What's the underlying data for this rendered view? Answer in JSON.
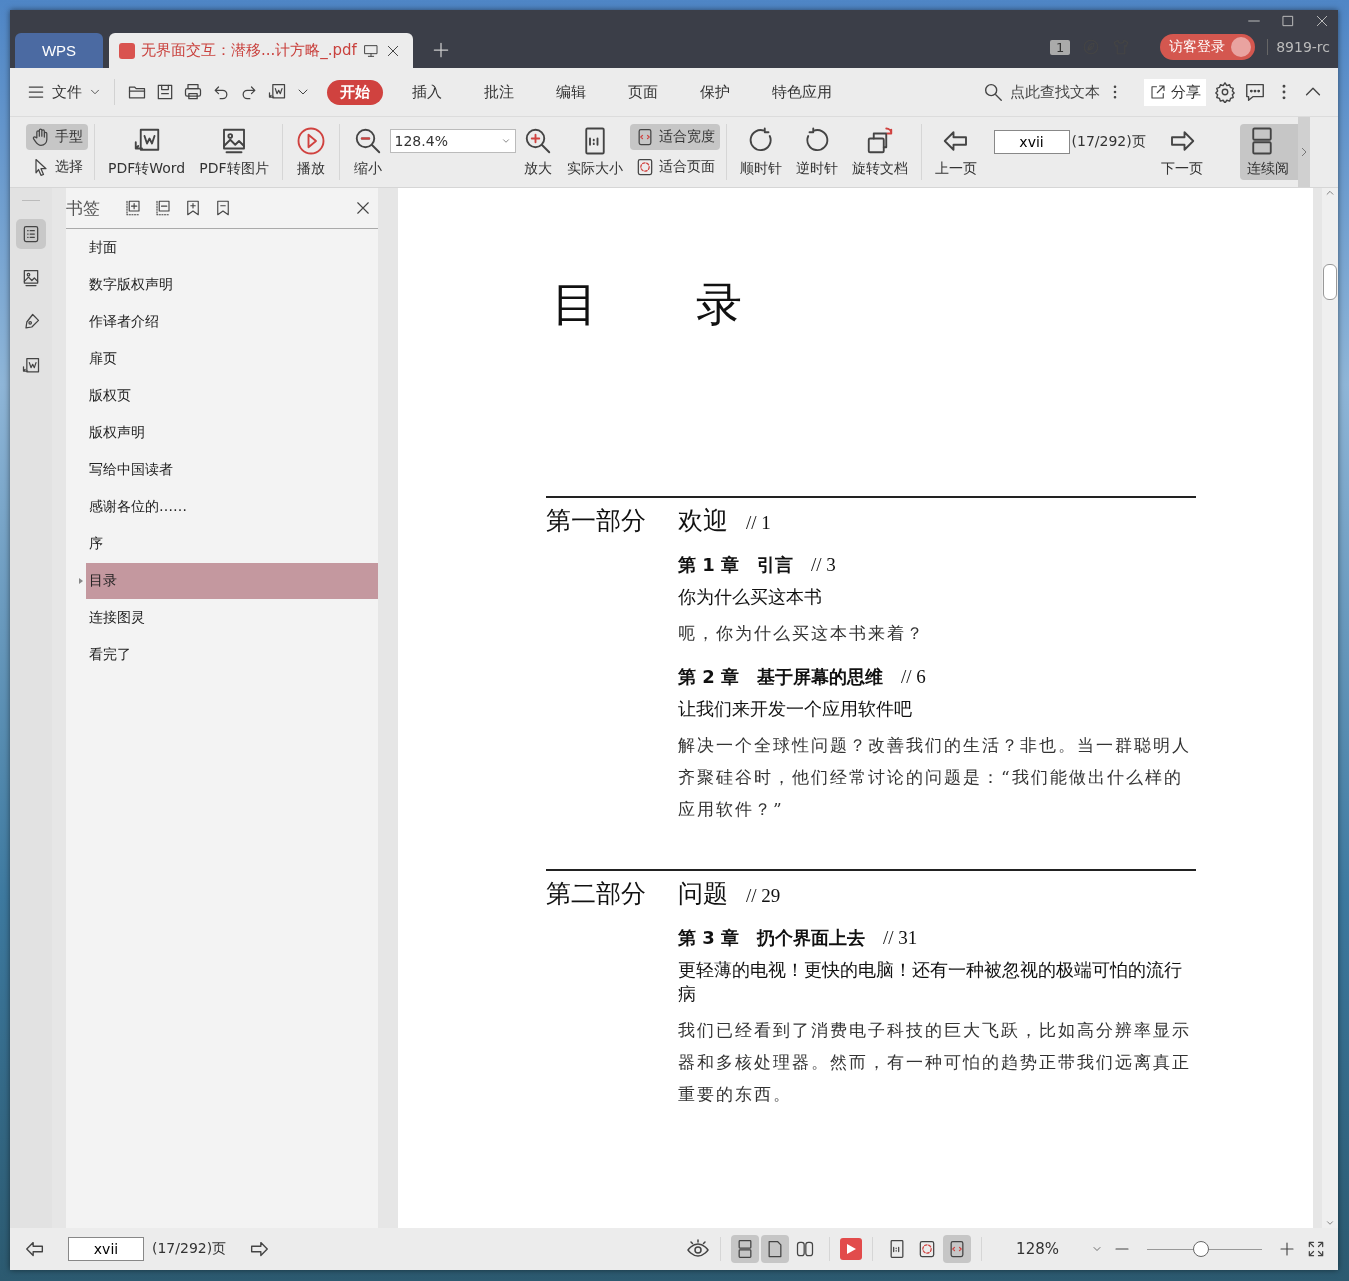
{
  "title_bar": {
    "home_tab": "WPS",
    "tabs": [
      {
        "label": "无界面交互：潜移...计方略_.pdf",
        "selected": true
      }
    ],
    "page_badge": "1",
    "login_button": "访客登录",
    "user_name": "8919-rc"
  },
  "menu_bar": {
    "file_menu": "文件",
    "tabs": [
      {
        "label": "开始",
        "selected": true
      },
      {
        "label": "插入",
        "selected": false
      },
      {
        "label": "批注",
        "selected": false
      },
      {
        "label": "编辑",
        "selected": false
      },
      {
        "label": "页面",
        "selected": false
      },
      {
        "label": "保护",
        "selected": false
      },
      {
        "label": "特色应用",
        "selected": false
      }
    ],
    "search": {
      "placeholder": "点此查找文本"
    },
    "share_button": "分享"
  },
  "ribbon": {
    "hand_tool": {
      "label": "手型",
      "selected": true
    },
    "select_tool": {
      "label": "选择",
      "selected": false
    },
    "pdf_to_word": "PDF转Word",
    "pdf_to_image": "PDF转图片",
    "play": "播放",
    "zoom_out": "缩小",
    "zoom_value": "128.4%",
    "zoom_in": "放大",
    "actual_size": "实际大小",
    "fit_width": {
      "label": "适合宽度",
      "selected": true
    },
    "fit_page": {
      "label": "适合页面",
      "selected": false
    },
    "rotate_cw": "顺时针",
    "rotate_ccw": "逆时针",
    "rotate_doc": "旋转文档",
    "prev_page": "上一页",
    "page_field": "xvii",
    "page_count": "(17/292)页",
    "next_page": "下一页",
    "continuous": {
      "label": "连续阅",
      "selected": true
    }
  },
  "rail": [
    {
      "selected": true
    },
    {
      "selected": false
    },
    {
      "selected": false
    },
    {
      "selected": false
    }
  ],
  "bookmarks": {
    "title": "书签",
    "items": [
      {
        "label": "封面",
        "selected": false,
        "expandable": false
      },
      {
        "label": "数字版权声明",
        "selected": false,
        "expandable": false
      },
      {
        "label": "作译者介绍",
        "selected": false,
        "expandable": false
      },
      {
        "label": "扉页",
        "selected": false,
        "expandable": false
      },
      {
        "label": "版权页",
        "selected": false,
        "expandable": false
      },
      {
        "label": "版权声明",
        "selected": false,
        "expandable": false
      },
      {
        "label": "写给中国读者",
        "selected": false,
        "expandable": false
      },
      {
        "label": "感谢各位的……",
        "selected": false,
        "expandable": false
      },
      {
        "label": "序",
        "selected": false,
        "expandable": false
      },
      {
        "label": "目录",
        "selected": true,
        "expandable": true
      },
      {
        "label": "连接图灵",
        "selected": false,
        "expandable": false
      },
      {
        "label": "看完了",
        "selected": false,
        "expandable": false
      }
    ]
  },
  "document": {
    "title": "目　　录",
    "parts": [
      {
        "name": "第一部分",
        "title": "欢迎",
        "page": "// 1",
        "chapters": [
          {
            "number": "第 1 章",
            "title": "引言",
            "page": "// 3",
            "subtitle": "你为什么买这本书",
            "summary": "呃，你为什么买这本书来着？"
          },
          {
            "number": "第 2 章",
            "title": "基于屏幕的思维",
            "page": "// 6",
            "subtitle": "让我们来开发一个应用软件吧",
            "summary": "解决一个全球性问题？改善我们的生活？非也。当一群聪明人齐聚硅谷时，他们经常讨论的问题是：“我们能做出什么样的应用软件？”"
          }
        ]
      },
      {
        "name": "第二部分",
        "title": "问题",
        "page": "// 29",
        "chapters": [
          {
            "number": "第 3 章",
            "title": "扔个界面上去",
            "page": "// 31",
            "subtitle": "更轻薄的电视！更快的电脑！还有一种被忽视的极端可怕的流行病",
            "summary": "我们已经看到了消费电子科技的巨大飞跃，比如高分辨率显示器和多核处理器。然而，有一种可怕的趋势正带我们远离真正重要的东西。"
          }
        ]
      }
    ]
  },
  "status_bar": {
    "page_field": "xvii",
    "page_count": "(17/292)页",
    "view_modes": [
      {
        "selected": true
      },
      {
        "selected": true
      },
      {
        "selected": false
      }
    ],
    "fit_modes": [
      {
        "selected": false
      },
      {
        "selected": false
      },
      {
        "selected": true
      }
    ],
    "zoom": "128%",
    "zoom_slider": {
      "level": 0.47
    }
  }
}
